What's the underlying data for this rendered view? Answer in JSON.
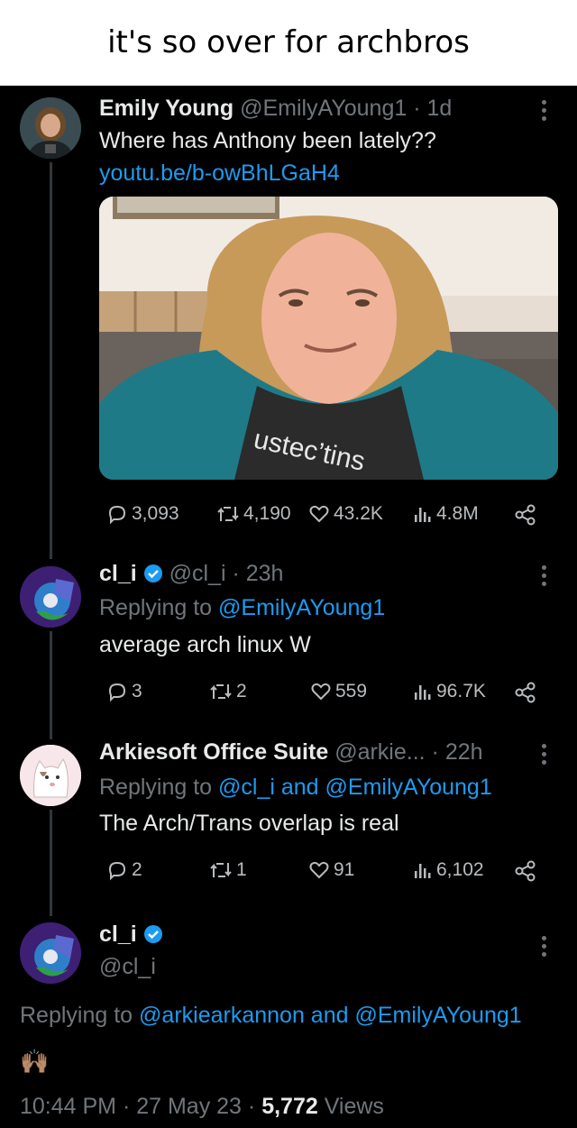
{
  "caption": "it's so over for archbros",
  "tweets": [
    {
      "name": "Emily Young",
      "handle": "@EmilyAYoung1",
      "time": "· 1d",
      "text": "Where has Anthony been lately??",
      "link": "youtu.be/b-owBhLGaH4",
      "media_shirt_text": "ustec’tins",
      "stats": {
        "replies": "3,093",
        "reposts": "4,190",
        "likes": "43.2K",
        "views": "4.8M"
      }
    },
    {
      "name": "cl_i",
      "handle": "@cl_i",
      "time": "· 23h",
      "replying_prefix": "Replying to ",
      "replying_to": "@EmilyAYoung1",
      "text": "average arch linux W",
      "stats": {
        "replies": "3",
        "reposts": "2",
        "likes": "559",
        "views": "96.7K"
      }
    },
    {
      "name": "Arkiesoft Office Suite",
      "handle": "@arkie...",
      "time": "· 22h",
      "replying_prefix": "Replying to ",
      "replying_to_1": "@cl_i",
      "replying_and": " and ",
      "replying_to_2": "@EmilyAYoung1",
      "text": "The Arch/Trans overlap is real",
      "stats": {
        "replies": "2",
        "reposts": "1",
        "likes": "91",
        "views": "6,102"
      }
    }
  ],
  "main_tweet": {
    "name": "cl_i",
    "handle": "@cl_i",
    "replying_prefix": "Replying to ",
    "replying_to_1": "@arkiearkannon",
    "replying_and": " and ",
    "replying_to_2": "@EmilyAYoung1",
    "emoji": "🙌🏽",
    "timestamp": "10:44 PM · 27 May 23 · ",
    "views_count": "5,772",
    "views_label": " Views"
  },
  "colors": {
    "background": "#000000",
    "text": "#e7e9ea",
    "muted": "#71767b",
    "link": "#1d9bf0",
    "verified": "#1d9bf0"
  }
}
